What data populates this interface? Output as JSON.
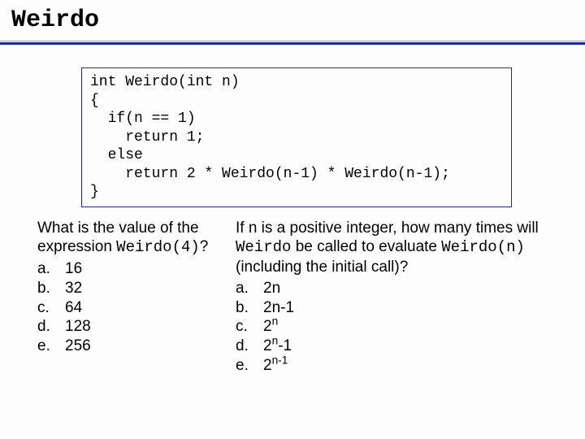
{
  "title": "Weirdo",
  "code": "int Weirdo(int n)\n{\n  if(n == 1)\n    return 1;\n  else\n    return 2 * Weirdo(n-1) * Weirdo(n-1);\n}",
  "question1": {
    "prompt_pre": "What is the value of the expression ",
    "prompt_code": "Weirdo(4)",
    "prompt_post": "?",
    "options": [
      {
        "label": "a.",
        "value": "16"
      },
      {
        "label": "b.",
        "value": "32"
      },
      {
        "label": "c.",
        "value": "64"
      },
      {
        "label": "d.",
        "value": "128"
      },
      {
        "label": "e.",
        "value": "256"
      }
    ]
  },
  "question2": {
    "prompt_pre": "If n is a positive integer, how many times will ",
    "prompt_code1": "Weirdo",
    "prompt_mid": " be called to evaluate ",
    "prompt_code2": "Weirdo(n)",
    "prompt_post": " (including the initial call)?",
    "options": [
      {
        "label": "a.",
        "value_html": "2n"
      },
      {
        "label": "b.",
        "value_html": "2n-1"
      },
      {
        "label": "c.",
        "value_html": "2<sup>n</sup>"
      },
      {
        "label": "d.",
        "value_html": "2<sup>n</sup>-1"
      },
      {
        "label": "e.",
        "value_html": "2<sup>n-1</sup>"
      }
    ]
  }
}
